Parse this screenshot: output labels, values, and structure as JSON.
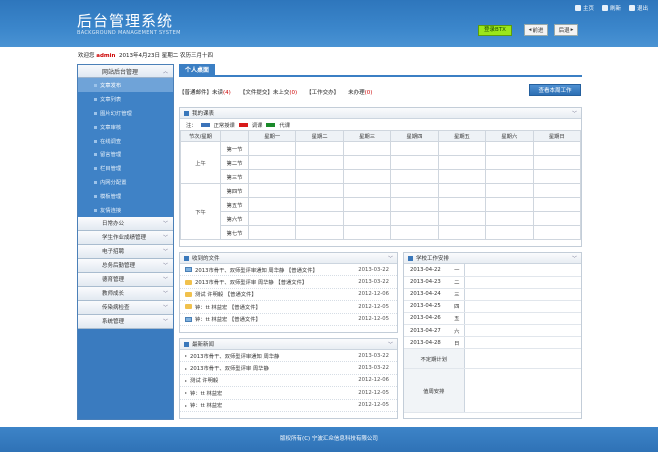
{
  "header": {
    "title": "后台管理系统",
    "subtitle": "BACKGROUND MANAGEMENT SYSTEM",
    "nav": [
      "主页",
      "刷新",
      "退出"
    ],
    "login_btn": "登录BTX",
    "back_btn": "前进",
    "forward_btn": "后退"
  },
  "info": {
    "welcome": "欢迎您",
    "user": "admin",
    "date": "2013年4月23日 星期二 农历三月十四"
  },
  "sidebar": {
    "group_active": "网站后台管理",
    "sub_items": [
      "文章发布",
      "文章列表",
      "图片幻灯管理",
      "文章审核",
      "在线调查",
      "留言管理",
      "栏目管理",
      "内网分配置",
      "模板管理",
      "友情连接"
    ],
    "groups": [
      "日常办公",
      "学生作业成绩管理",
      "电子招聘",
      "总务后勤管理",
      "德育管理",
      "教师成长",
      "传染病检查",
      "系统管理"
    ]
  },
  "main": {
    "tab": "个人桌面",
    "quick": [
      {
        "label": "【普通邮件】未读",
        "n": "(4)"
      },
      {
        "label": "【文件提交】未上交",
        "n": "(0)"
      },
      {
        "label": "【工作交办】",
        "n": ""
      },
      {
        "label": "未办理",
        "n": "(0)"
      }
    ],
    "week_btn": "查看本周工作"
  },
  "schedule": {
    "title": "我的课表",
    "legend_prefix": "注：",
    "legend": [
      {
        "label": "正常授课",
        "color": "#3b73b9"
      },
      {
        "label": "调课",
        "color": "#d81b1b"
      },
      {
        "label": "代课",
        "color": "#1a8a2a"
      }
    ],
    "head": [
      "节次/星期",
      "星期一",
      "星期二",
      "星期三",
      "星期四",
      "星期五",
      "星期六",
      "星期日"
    ],
    "am": "上午",
    "pm": "下午",
    "periods": [
      "第一节",
      "第二节",
      "第三节",
      "第四节",
      "第五节",
      "第六节",
      "第七节"
    ]
  },
  "files": {
    "title": "收到的文件",
    "rows": [
      {
        "icon": "mail",
        "text": "2013市骨干、双师型评审通知 周华静 【普通文件】",
        "date": "2013-03-22"
      },
      {
        "icon": "folder",
        "text": "2013市骨干、双师型评审 周华静 【普通文件】",
        "date": "2013-03-22"
      },
      {
        "icon": "folder",
        "text": "测试 许明毅 【普通文件】",
        "date": "2012-12-06"
      },
      {
        "icon": "folder",
        "text": "钟：tt 林益宏 【普通文件】",
        "date": "2012-12-05"
      },
      {
        "icon": "mail",
        "text": "钟：tt 林益宏 【普通文件】",
        "date": "2012-12-05"
      }
    ]
  },
  "news": {
    "title": "最新新闻",
    "rows": [
      {
        "text": "2013市骨干、双师型评审通知 周华静",
        "date": "2013-03-22"
      },
      {
        "text": "2013市骨干、双师型评审 周华静",
        "date": "2013-03-22"
      },
      {
        "text": "测试 许明毅",
        "date": "2012-12-06"
      },
      {
        "text": "钟：tt 林益宏",
        "date": "2012-12-05"
      },
      {
        "text": "钟：tt 林益宏",
        "date": "2012-12-05"
      }
    ]
  },
  "school": {
    "title": "学校工作安排",
    "rows": [
      {
        "date": "2013-04-22",
        "day": "一"
      },
      {
        "date": "2013-04-23",
        "day": "二"
      },
      {
        "date": "2013-04-24",
        "day": "三"
      },
      {
        "date": "2013-04-25",
        "day": "四"
      },
      {
        "date": "2013-04-26",
        "day": "五"
      },
      {
        "date": "2013-04-27",
        "day": "六"
      },
      {
        "date": "2013-04-28",
        "day": "日"
      }
    ],
    "irregular": "不定期计划",
    "duty": "值周安排"
  },
  "footer": "版权所有(C) 宁波汇众信息科技有限公司"
}
